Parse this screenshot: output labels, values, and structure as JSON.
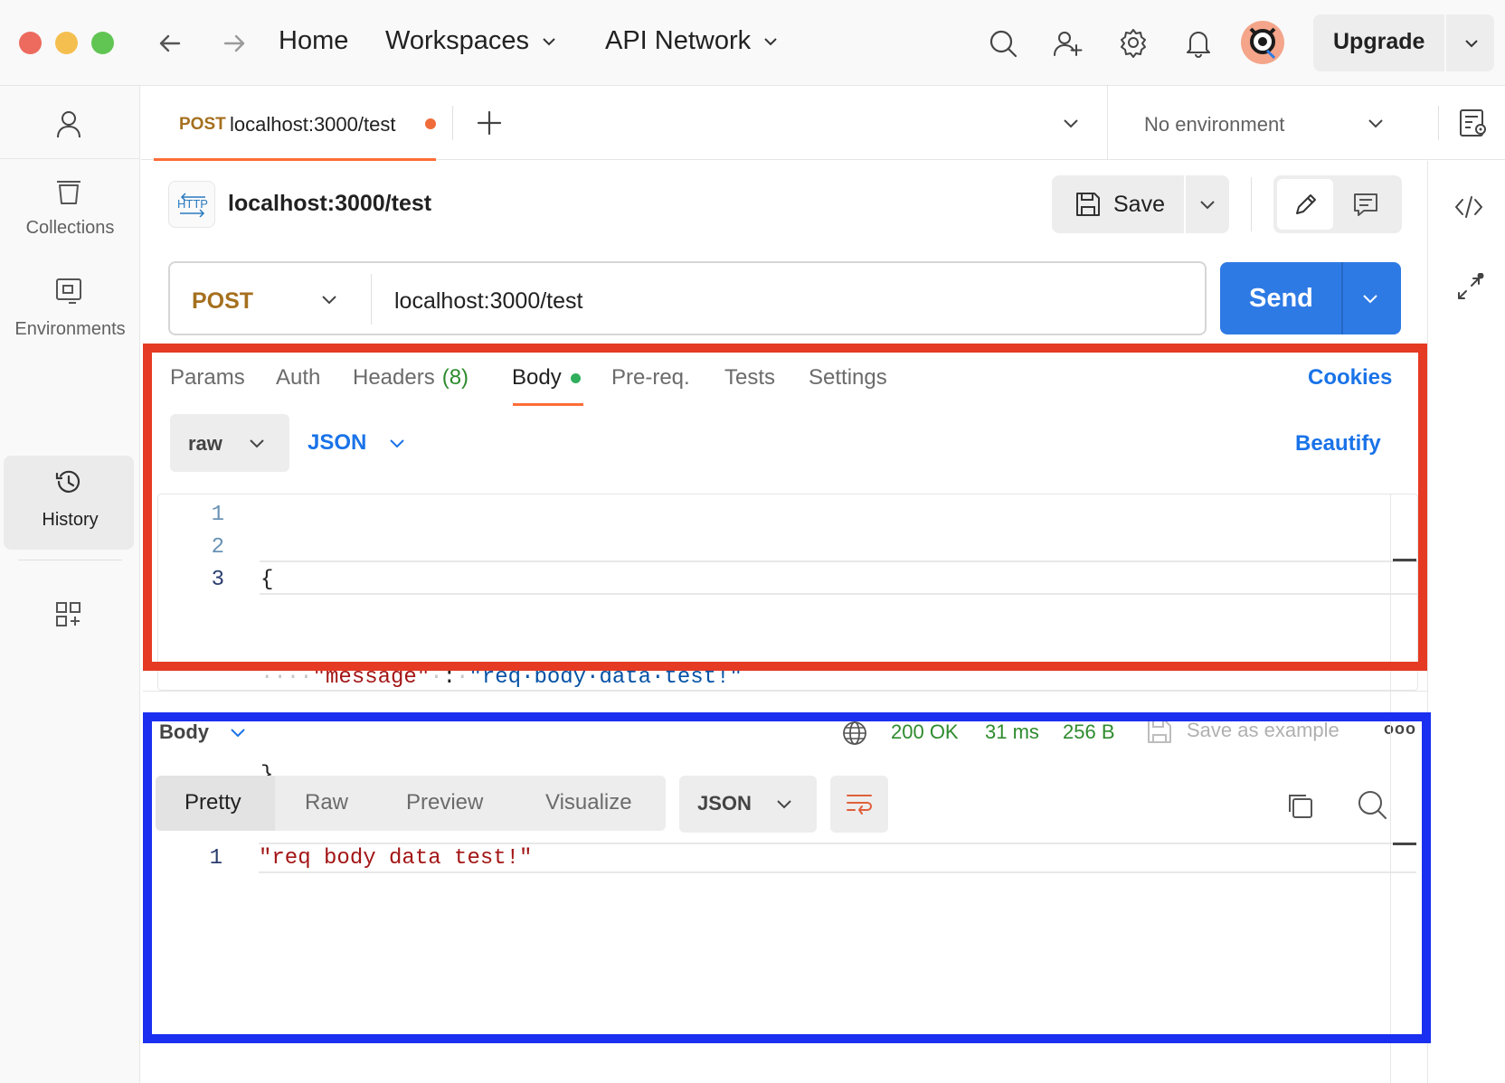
{
  "window": {
    "traffic_lights": [
      "#ed6a5e",
      "#f5bf4f",
      "#61c554"
    ]
  },
  "topnav": {
    "home": "Home",
    "workspaces": "Workspaces",
    "api_network": "API Network",
    "upgrade": "Upgrade"
  },
  "sidebar": {
    "items": [
      {
        "label": "Collections",
        "icon": "collections-icon"
      },
      {
        "label": "Environments",
        "icon": "environments-icon"
      },
      {
        "label": "History",
        "icon": "history-icon",
        "active": true
      }
    ]
  },
  "tab": {
    "method": "POST",
    "url": "localhost:3000/test",
    "environment": "No environment"
  },
  "request": {
    "title": "localhost:3000/test",
    "badge": "HTTP",
    "save_label": "Save",
    "method": "POST",
    "url": "localhost:3000/test",
    "send_label": "Send",
    "tabs": {
      "params": "Params",
      "auth": "Auth",
      "headers": "Headers",
      "headers_count": "(8)",
      "body": "Body",
      "prereq": "Pre-req.",
      "tests": "Tests",
      "settings": "Settings"
    },
    "cookies": "Cookies",
    "body_mode": "raw",
    "body_lang": "JSON",
    "beautify": "Beautify",
    "code": {
      "line_numbers": [
        "1",
        "2",
        "3"
      ],
      "open_brace": "{",
      "indent": "····",
      "key": "\"message\"",
      "ws_before_colon": "·",
      "colon": ":",
      "ws_after_colon": "·",
      "value": "\"req·body·data·test!\"",
      "close_brace": "}"
    }
  },
  "response": {
    "label": "Body",
    "status": "200 OK",
    "time": "31 ms",
    "size": "256 B",
    "save_example": "Save as example",
    "more": "ooo",
    "view_tabs": [
      "Pretty",
      "Raw",
      "Preview",
      "Visualize"
    ],
    "format": "JSON",
    "line_number": "1",
    "content": "\"req body data test!\""
  },
  "colors": {
    "accent_orange": "#ff6c37",
    "send_blue": "#2e7ae5",
    "method_post": "#a5701f",
    "status_green": "#2e8b2e",
    "highlight_red": "#e53a23",
    "highlight_blue": "#1a2ff0"
  }
}
